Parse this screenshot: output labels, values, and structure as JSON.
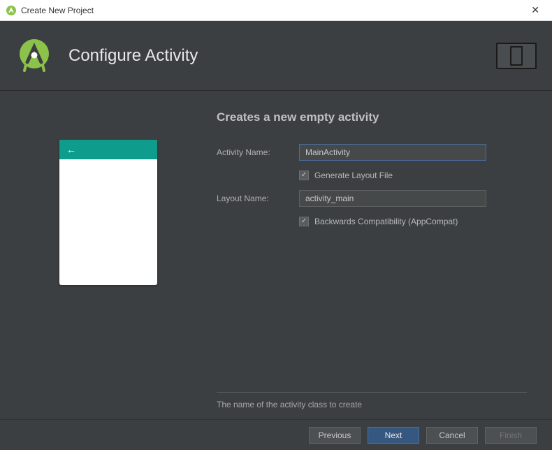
{
  "window": {
    "title": "Create New Project"
  },
  "header": {
    "title": "Configure Activity"
  },
  "section": {
    "heading": "Creates a new empty activity"
  },
  "form": {
    "activity_name_label": "Activity Name:",
    "activity_name_value": "MainActivity",
    "generate_layout_label": "Generate Layout File",
    "generate_layout_checked": true,
    "layout_name_label": "Layout Name:",
    "layout_name_value": "activity_main",
    "backwards_compat_label": "Backwards Compatibility (AppCompat)",
    "backwards_compat_checked": true
  },
  "help": {
    "text": "The name of the activity class to create"
  },
  "buttons": {
    "previous": "Previous",
    "next": "Next",
    "cancel": "Cancel",
    "finish": "Finish"
  },
  "colors": {
    "accent_teal": "#0e9d8c",
    "logo_green": "#8bc34a",
    "primary_blue": "#365880"
  }
}
